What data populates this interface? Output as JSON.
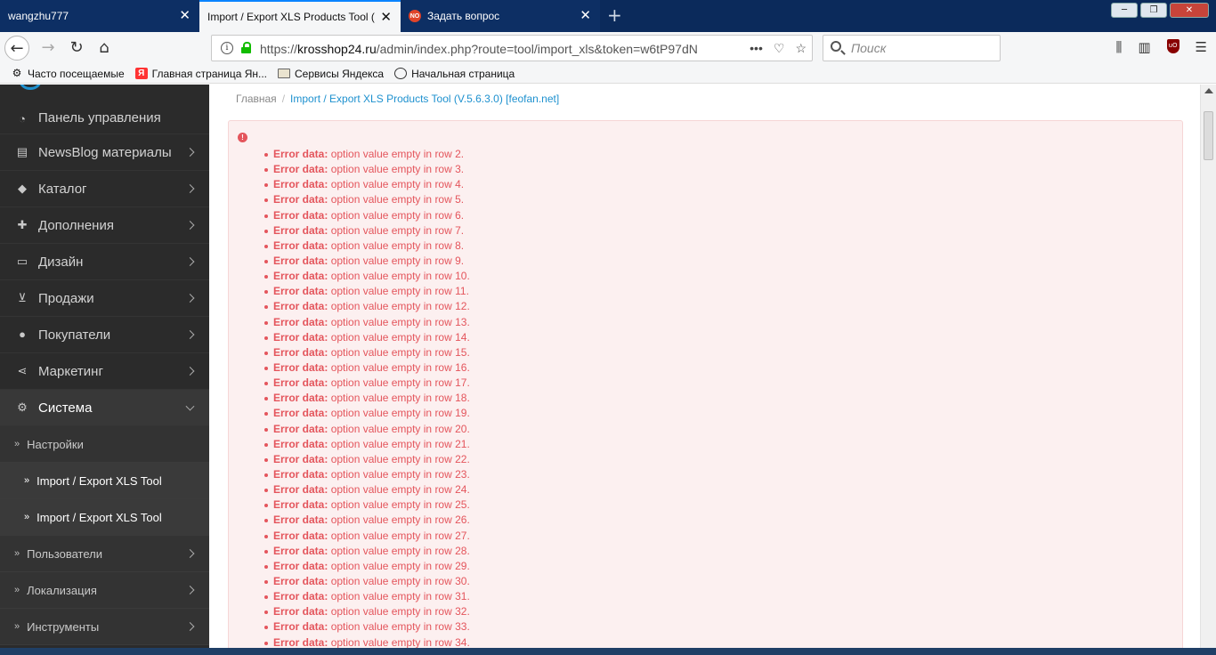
{
  "browser": {
    "tabs": [
      {
        "label": "wangzhu777",
        "active": false
      },
      {
        "label": "Import / Export XLS Products Tool (",
        "active": true
      },
      {
        "label": "Задать вопрос",
        "active": false,
        "icon_text": "NO"
      }
    ],
    "address": {
      "prefix": "https://",
      "domain": "krosshop24.ru",
      "path": "/admin/index.php?route=tool/import_xls&token=w6tP97dN"
    },
    "search_placeholder": "Поиск",
    "bookmarks": [
      {
        "label": "Часто посещаемые",
        "icon": "gear-icon"
      },
      {
        "label": "Главная страница Ян...",
        "icon": "yandex-icon",
        "icon_text": "Я"
      },
      {
        "label": "Сервисы Яндекса",
        "icon": "folder-icon"
      },
      {
        "label": "Начальная страница",
        "icon": "globe-icon"
      }
    ]
  },
  "sidebar": {
    "items": [
      {
        "label": "Панель управления",
        "icon": "dashboard-icon"
      },
      {
        "label": "NewsBlog материалы",
        "icon": "newspaper-icon"
      },
      {
        "label": "Каталог",
        "icon": "tag-icon"
      },
      {
        "label": "Дополнения",
        "icon": "puzzle-icon"
      },
      {
        "label": "Дизайн",
        "icon": "monitor-icon"
      },
      {
        "label": "Продажи",
        "icon": "cart-icon"
      },
      {
        "label": "Покупатели",
        "icon": "user-icon"
      },
      {
        "label": "Маркетинг",
        "icon": "share-icon"
      },
      {
        "label": "Система",
        "icon": "cog-icon"
      }
    ],
    "subitems": [
      {
        "label": "Настройки"
      },
      {
        "label": "Import / Export XLS Tool"
      },
      {
        "label": "Import / Export XLS Tool"
      },
      {
        "label": "Пользователи"
      },
      {
        "label": "Локализация"
      },
      {
        "label": "Инструменты"
      }
    ]
  },
  "breadcrumb": {
    "home": "Главная",
    "separator": "/",
    "current": "Import / Export XLS Products Tool (V.5.6.3.0) [feofan.net]"
  },
  "errors": {
    "label": "Error data:",
    "rows": [
      "option value empty in row 2.",
      "option value empty in row 3.",
      "option value empty in row 4.",
      "option value empty in row 5.",
      "option value empty in row 6.",
      "option value empty in row 7.",
      "option value empty in row 8.",
      "option value empty in row 9.",
      "option value empty in row 10.",
      "option value empty in row 11.",
      "option value empty in row 12.",
      "option value empty in row 13.",
      "option value empty in row 14.",
      "option value empty in row 15.",
      "option value empty in row 16.",
      "option value empty in row 17.",
      "option value empty in row 18.",
      "option value empty in row 19.",
      "option value empty in row 20.",
      "option value empty in row 21.",
      "option value empty in row 22.",
      "option value empty in row 23.",
      "option value empty in row 24.",
      "option value empty in row 25.",
      "option value empty in row 26.",
      "option value empty in row 27.",
      "option value empty in row 28.",
      "option value empty in row 29.",
      "option value empty in row 30.",
      "option value empty in row 31.",
      "option value empty in row 32.",
      "option value empty in row 33.",
      "option value empty in row 34."
    ]
  },
  "colors": {
    "error_text": "#e4555c",
    "alert_bg": "#fcf0f0",
    "sidebar_bg": "#2b2b2b",
    "link": "#1e91cf"
  }
}
